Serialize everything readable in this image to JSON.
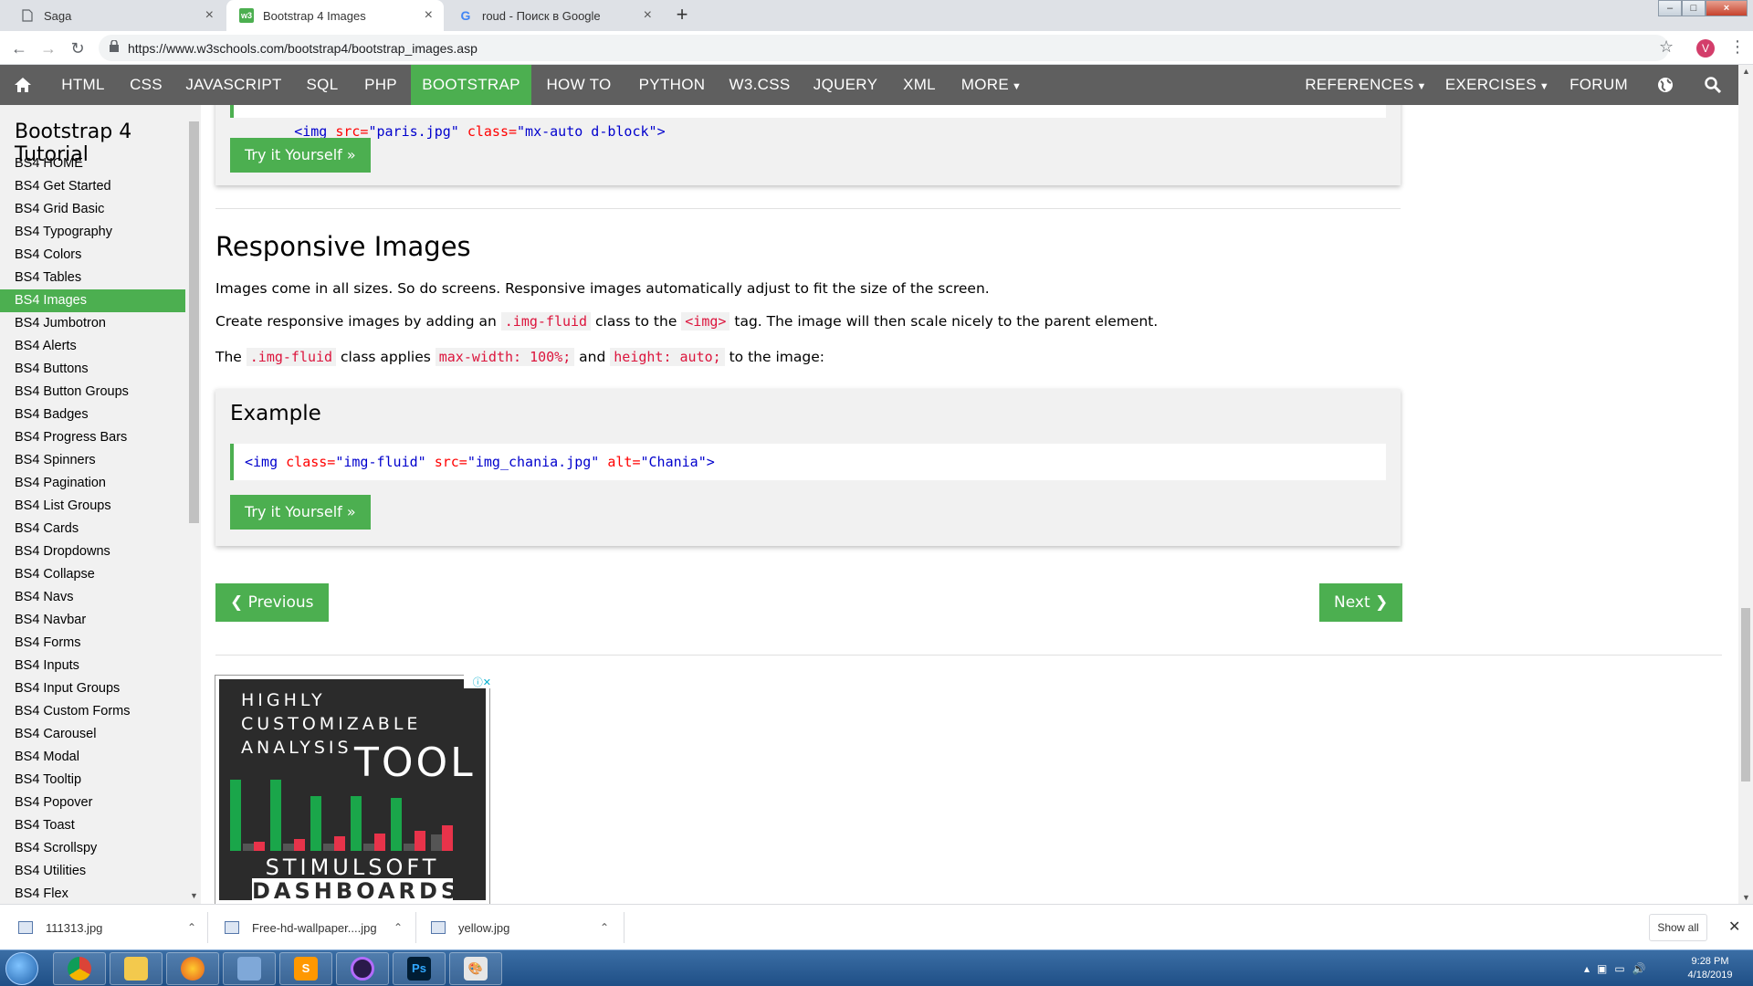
{
  "tabs": [
    {
      "title": "Saga",
      "active": false
    },
    {
      "title": "Bootstrap 4 Images",
      "active": true
    },
    {
      "title": "roud - Поиск в Google",
      "active": false
    }
  ],
  "address": {
    "url": "https://www.w3schools.com/bootstrap4/bootstrap_images.asp",
    "profile_initial": "V"
  },
  "topnav": {
    "items": [
      "HTML",
      "CSS",
      "JAVASCRIPT",
      "SQL",
      "PHP",
      "BOOTSTRAP",
      "HOW TO",
      "PYTHON",
      "W3.CSS",
      "JQUERY",
      "XML",
      "MORE"
    ],
    "active": "BOOTSTRAP",
    "right_items": [
      "REFERENCES",
      "EXERCISES",
      "FORUM"
    ]
  },
  "sidebar": {
    "title": "Bootstrap 4 Tutorial",
    "items": [
      "BS4 HOME",
      "BS4 Get Started",
      "BS4 Grid Basic",
      "BS4 Typography",
      "BS4 Colors",
      "BS4 Tables",
      "BS4 Images",
      "BS4 Jumbotron",
      "BS4 Alerts",
      "BS4 Buttons",
      "BS4 Button Groups",
      "BS4 Badges",
      "BS4 Progress Bars",
      "BS4 Spinners",
      "BS4 Pagination",
      "BS4 List Groups",
      "BS4 Cards",
      "BS4 Dropdowns",
      "BS4 Collapse",
      "BS4 Navs",
      "BS4 Navbar",
      "BS4 Forms",
      "BS4 Inputs",
      "BS4 Input Groups",
      "BS4 Custom Forms",
      "BS4 Carousel",
      "BS4 Modal",
      "BS4 Tooltip",
      "BS4 Popover",
      "BS4 Toast",
      "BS4 Scrollspy",
      "BS4 Utilities",
      "BS4 Flex"
    ],
    "active": "BS4 Images"
  },
  "prev_example": {
    "code_partial": "<img src=\"paris.jpg\" class=\"mx-auto d-block\">",
    "try_label": "Try it Yourself »"
  },
  "section": {
    "heading": "Responsive Images",
    "p1": "Images come in all sizes. So do screens. Responsive images automatically adjust to fit the size of the screen.",
    "p2_a": "Create responsive images by adding an ",
    "p2_code": ".img-fluid",
    "p2_b": " class to the ",
    "p2_code2": "<img>",
    "p2_c": " tag. The image will then scale nicely to the parent element.",
    "p3_a": "The ",
    "p3_code": ".img-fluid",
    "p3_b": " class applies ",
    "p3_code2": "max-width: 100%;",
    "p3_c": " and ",
    "p3_code3": "height: auto;",
    "p3_d": " to the image:"
  },
  "example": {
    "label": "Example",
    "code": {
      "tag_open": "<img",
      "a1": " class=",
      "v1": "\"img-fluid\"",
      "a2": " src=",
      "v2": "\"img_chania.jpg\"",
      "a3": " alt=",
      "v3": "\"Chania\"",
      "tag_close": ">"
    },
    "try_label": "Try it Yourself »"
  },
  "pager": {
    "prev": "❮ Previous",
    "next": "Next ❯"
  },
  "ad": {
    "line1": "HIGHLY",
    "line2": "CUSTOMIZABLE",
    "line3": "ANALYSIS",
    "tool": "TOOL",
    "brand1": "STIMULSOFT",
    "brand2": "DASHBOARDS",
    "green": "#1aa64a",
    "red": "#e8334a",
    "grey": "#555555"
  },
  "downloads": [
    {
      "name": "111313.jpg"
    },
    {
      "name": "Free-hd-wallpaper....jpg"
    },
    {
      "name": "yellow.jpg"
    }
  ],
  "downloads_show_all": "Show all",
  "taskbar": {
    "time": "9:28 PM",
    "date": "4/18/2019",
    "apps": [
      "chrome",
      "explorer",
      "firefox",
      "remote-desktop",
      "sublime",
      "screen-recorder",
      "photoshop",
      "paint"
    ]
  },
  "colors": {
    "w3_green": "#4caf50",
    "nav_grey": "#5f5f5f",
    "sidebar_bg": "#f1f1f1"
  }
}
